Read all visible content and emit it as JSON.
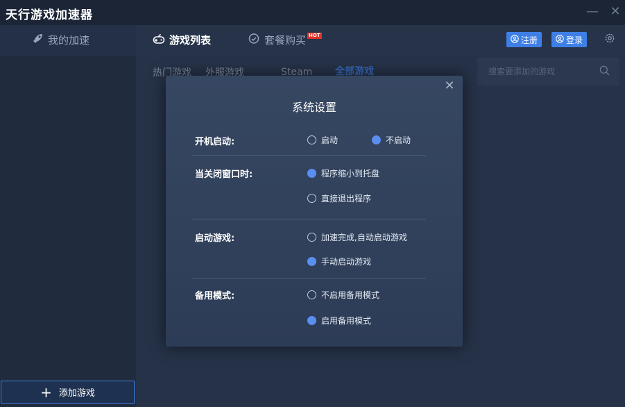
{
  "app": {
    "title": "天行游戏加速器"
  },
  "window_controls": {
    "minimize": "—",
    "close": "✕"
  },
  "nav": {
    "my_accel": "我的加速",
    "game_list": "游戏列表",
    "package": "套餐购买",
    "hot_badge": "HOT",
    "register": "注册",
    "login": "登录"
  },
  "tabs": [
    {
      "label": "热门游戏"
    },
    {
      "label": "外服游戏"
    },
    {
      "label": "Steam"
    },
    {
      "label": "全部游戏"
    }
  ],
  "search": {
    "placeholder": "搜索要添加的游戏"
  },
  "sidebar": {
    "add_game": "添加游戏"
  },
  "modal": {
    "close": "✕",
    "title": "系统设置",
    "rows": [
      {
        "label": "开机启动:",
        "options": [
          {
            "label": "启动",
            "selected": false
          },
          {
            "label": "不启动",
            "selected": true
          }
        ]
      },
      {
        "label": "当关闭窗口时:",
        "options": [
          {
            "label": "程序缩小到托盘",
            "selected": true
          },
          {
            "label": "直接退出程序",
            "selected": false
          }
        ]
      },
      {
        "label": "启动游戏:",
        "options": [
          {
            "label": "加速完成,自动启动游戏",
            "selected": false
          },
          {
            "label": "手动启动游戏",
            "selected": true
          }
        ]
      },
      {
        "label": "备用模式:",
        "options": [
          {
            "label": "不启用备用模式",
            "selected": false
          },
          {
            "label": "启用备用模式",
            "selected": true
          }
        ]
      }
    ]
  },
  "colors": {
    "accent": "#3e7fe6",
    "radio_selected": "#5a8ff0",
    "hot": "#e0322a",
    "background": "#1b2536"
  }
}
